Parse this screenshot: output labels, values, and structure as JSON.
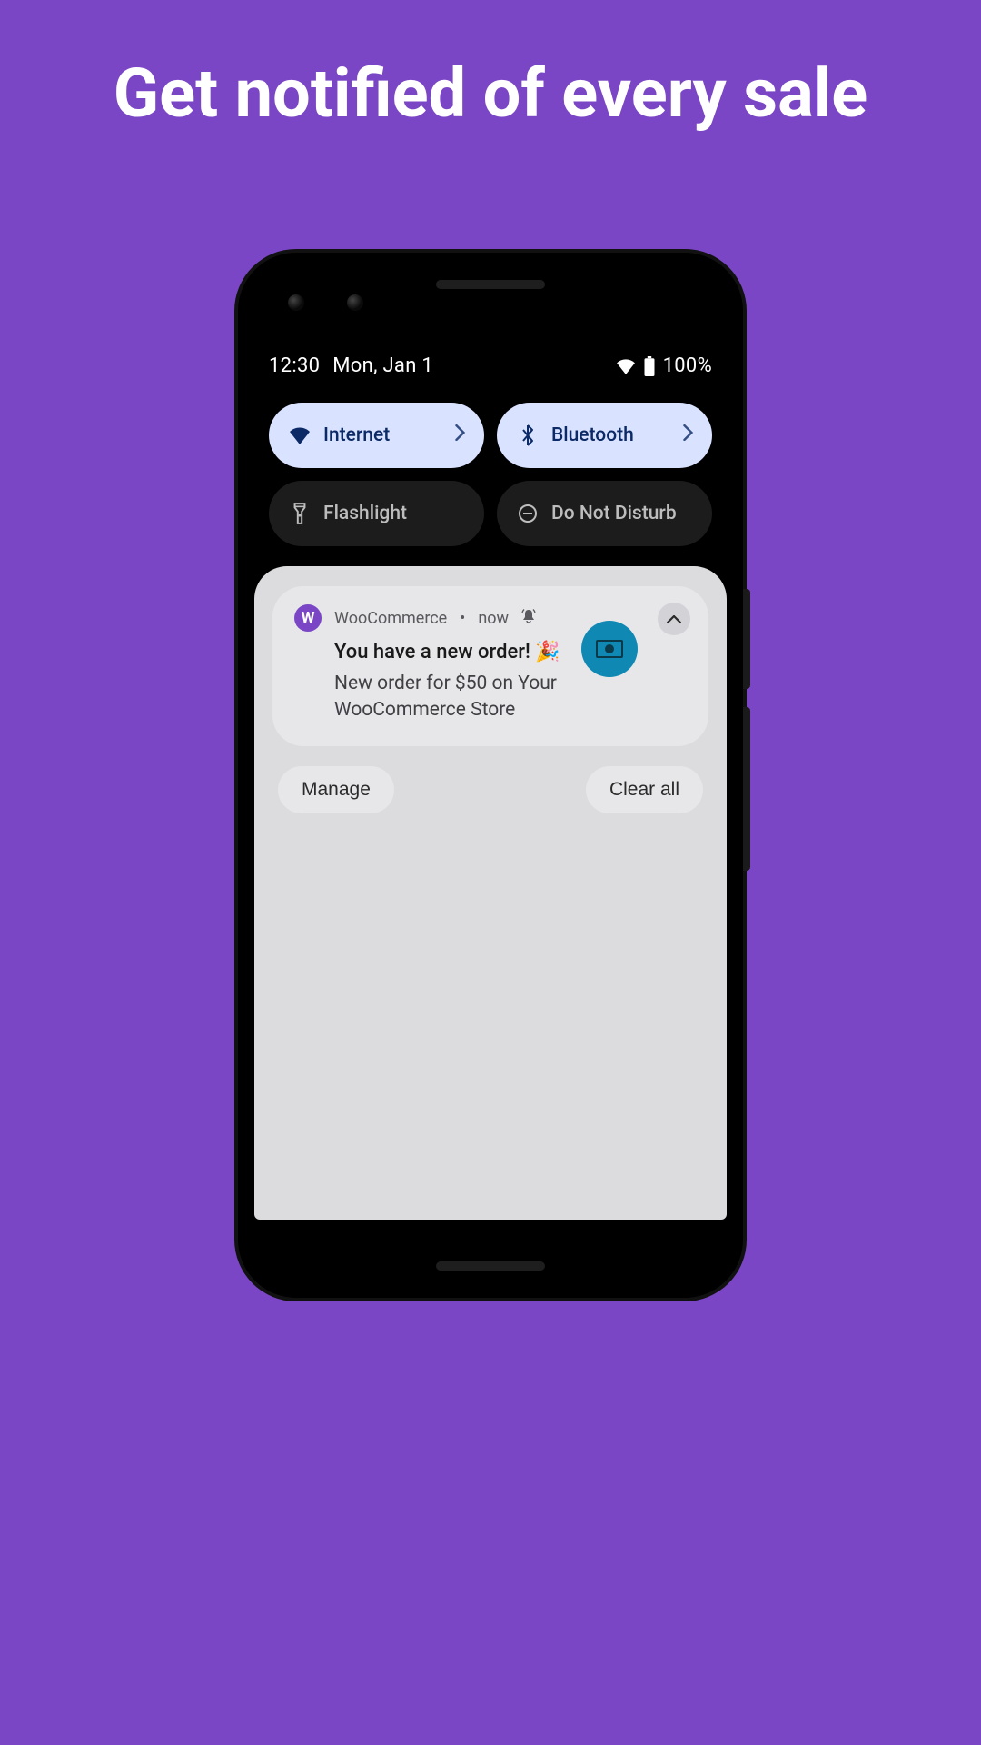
{
  "hero": {
    "title": "Get notified of every sale"
  },
  "status": {
    "time": "12:30",
    "date": "Mon, Jan 1",
    "battery_text": "100%"
  },
  "qs": {
    "internet": "Internet",
    "bluetooth": "Bluetooth",
    "flashlight": "Flashlight",
    "dnd": "Do Not Disturb"
  },
  "notification": {
    "app_initial": "W",
    "app_name": "WooCommerce",
    "sep": "•",
    "time": "now",
    "title": "You have a new order! 🎉",
    "body": "New order for $50 on Your WooCommerce Store"
  },
  "shade_actions": {
    "manage": "Manage",
    "clear_all": "Clear all"
  }
}
